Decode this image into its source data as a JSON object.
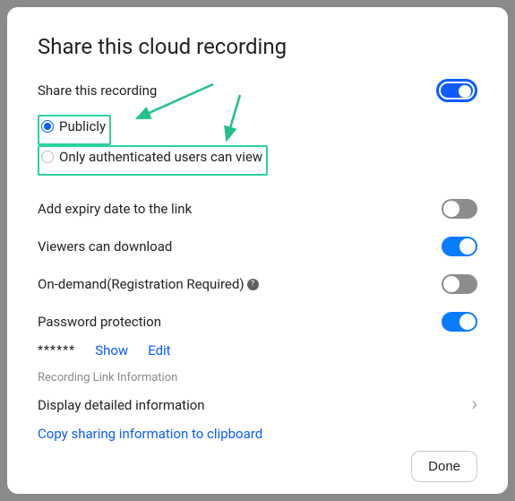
{
  "dialog": {
    "title": "Share this cloud recording"
  },
  "share": {
    "label": "Share this recording",
    "options": {
      "public": "Publicly",
      "auth": "Only authenticated users can view"
    }
  },
  "settings": {
    "expiry": "Add expiry date to the link",
    "download": "Viewers can download",
    "ondemand": "On-demand(Registration Required)",
    "password": "Password protection"
  },
  "password": {
    "mask": "******",
    "show": "Show",
    "edit": "Edit"
  },
  "linkinfo": {
    "heading": "Recording Link Information",
    "disclosure": "Display detailed information",
    "copy": "Copy sharing information to clipboard"
  },
  "footer": {
    "done": "Done"
  }
}
